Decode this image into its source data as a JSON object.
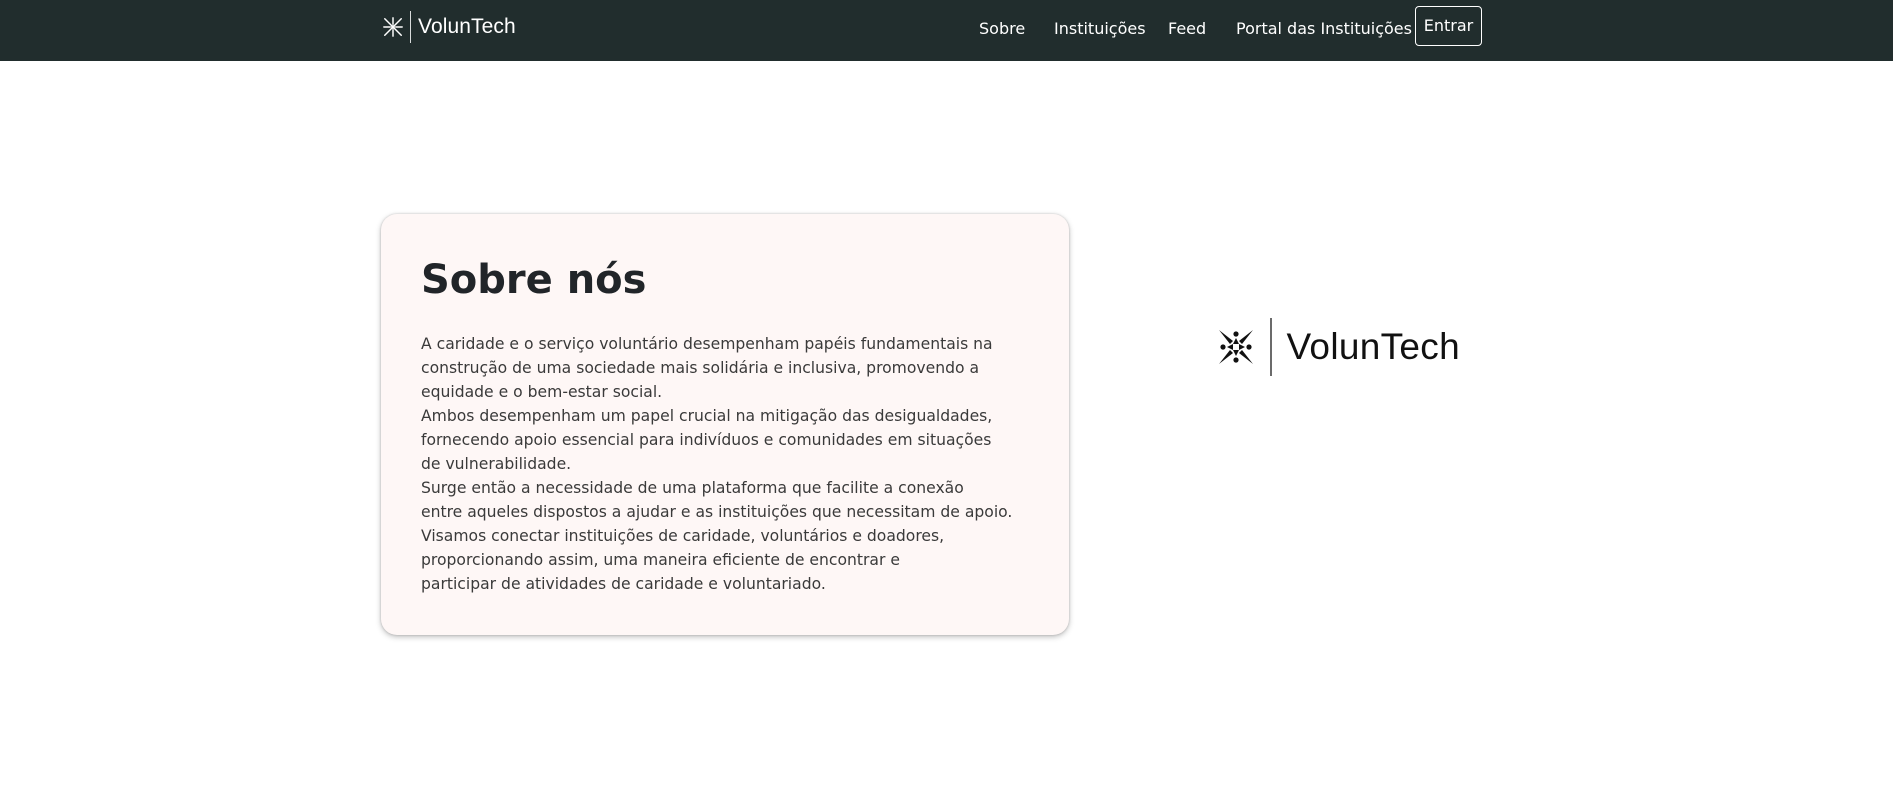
{
  "navbar": {
    "brand_icon": "voluntech-logo-icon",
    "brand_name": "VolunTech",
    "links": [
      "Sobre",
      "Instituições",
      "Feed",
      "Portal das Instituições"
    ],
    "login_button": "Entrar",
    "background_color": "#212d2d"
  },
  "about": {
    "title": "Sobre nós",
    "lines": [
      "A caridade e o serviço voluntário desempenham papéis fundamentais na",
      "construção de uma sociedade mais solidária e inclusiva, promovendo a",
      "equidade e o bem-estar social.",
      "Ambos desempenham um papel crucial na mitigação das desigualdades,",
      "fornecendo apoio essencial para indivíduos e comunidades em situações",
      "de vulnerabilidade.",
      "Surge então a necessidade de uma plataforma que facilite a conexão",
      "entre aqueles dispostos a ajudar e as instituições que necessitam de apoio.",
      "Visamos conectar instituições de caridade, voluntários e doadores,",
      "proporcionando assim, uma maneira eficiente de encontrar e",
      "participar de atividades de caridade e voluntariado."
    ],
    "card_background": "#fef7f6"
  },
  "hero_logo": {
    "icon": "voluntech-logo-icon",
    "name": "VolunTech"
  }
}
